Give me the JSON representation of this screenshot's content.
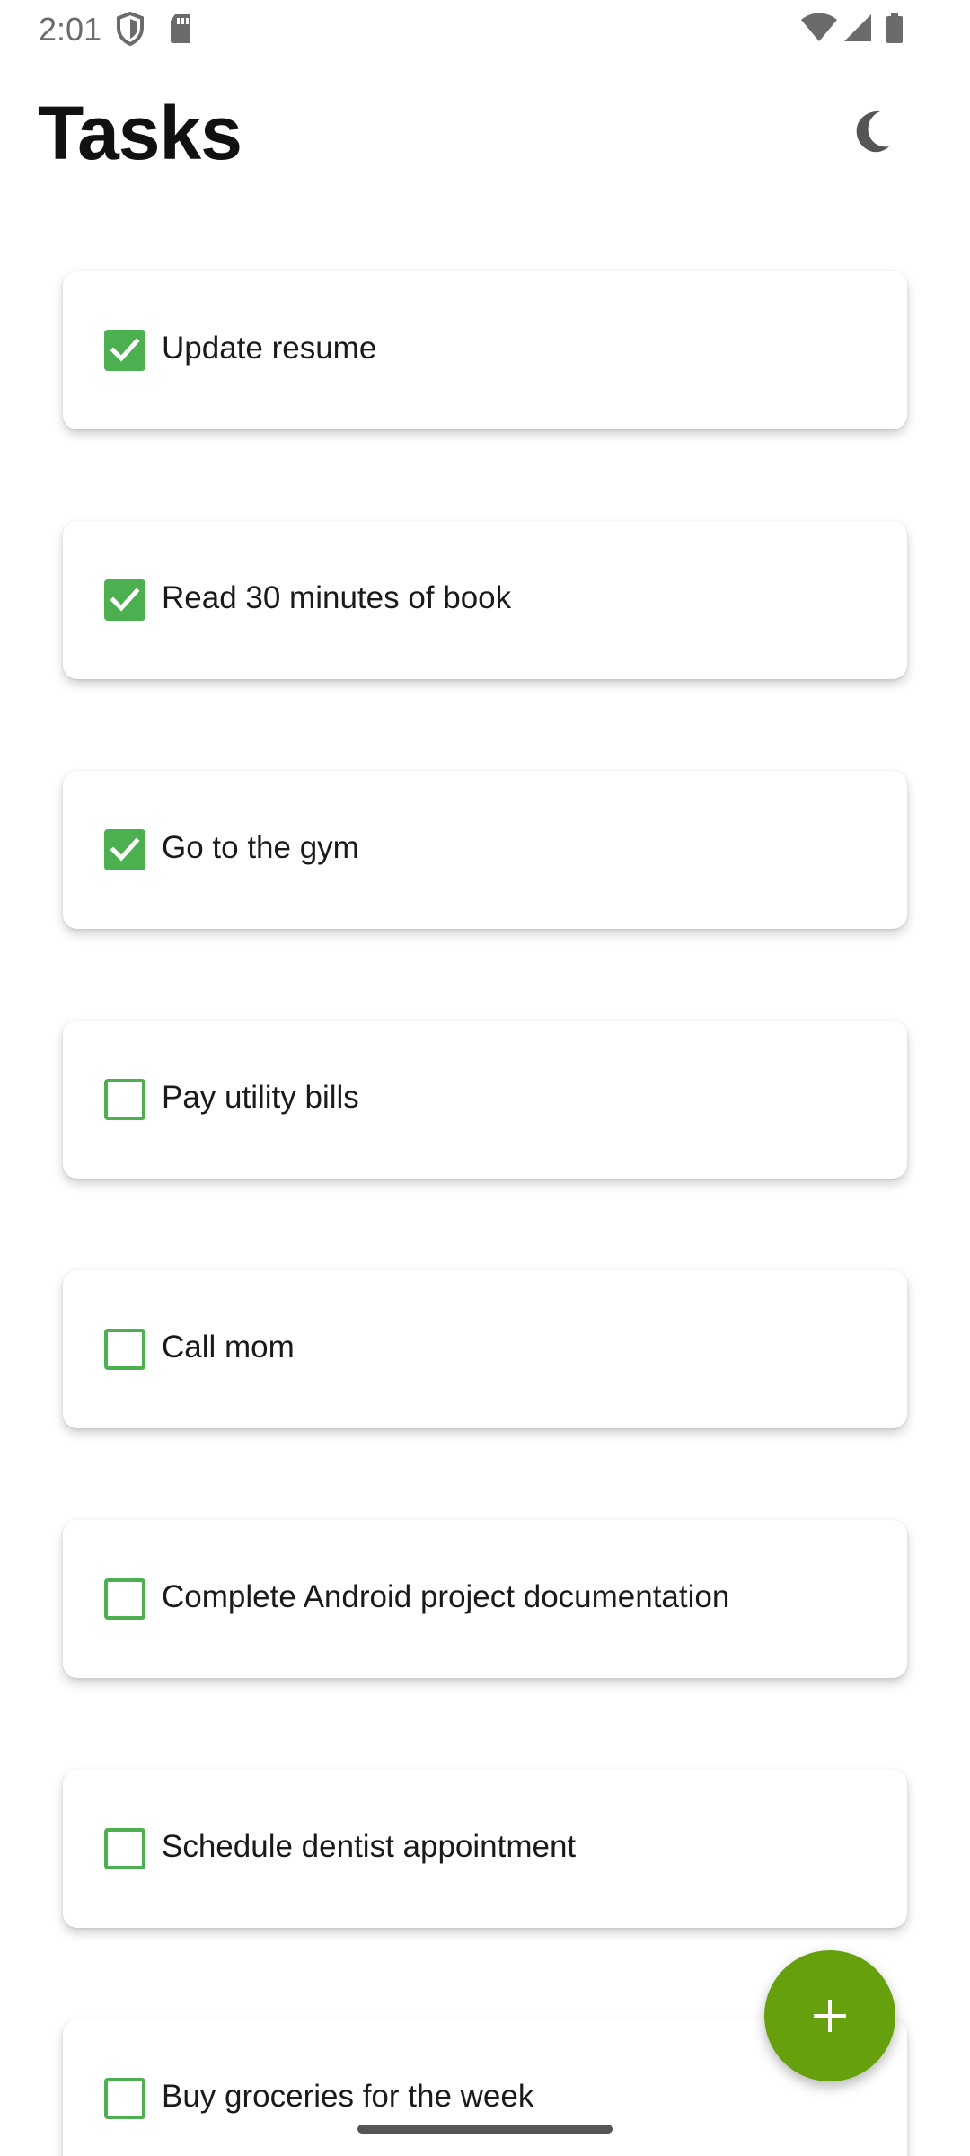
{
  "status_bar": {
    "time": "2:01",
    "icons": [
      "shield-icon",
      "sd-card-icon",
      "wifi-icon",
      "signal-icon",
      "battery-icon"
    ]
  },
  "header": {
    "title": "Tasks",
    "theme_toggle_icon": "moon-icon"
  },
  "tasks": [
    {
      "label": "Update resume",
      "done": true
    },
    {
      "label": "Read 30 minutes of book",
      "done": true
    },
    {
      "label": "Go to the gym",
      "done": true
    },
    {
      "label": "Pay utility bills",
      "done": false
    },
    {
      "label": "Call mom",
      "done": false
    },
    {
      "label": "Complete Android project documentation",
      "done": false
    },
    {
      "label": "Schedule dentist appointment",
      "done": false
    },
    {
      "label": "Buy groceries for the week",
      "done": false
    }
  ],
  "fab": {
    "icon": "plus-icon"
  },
  "colors": {
    "accent": "#4caf50",
    "fab": "#66a00d",
    "title": "#111111"
  }
}
